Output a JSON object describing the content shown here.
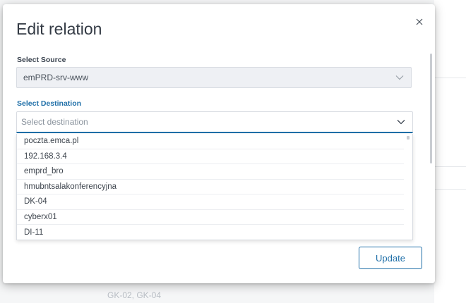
{
  "modal": {
    "title": "Edit relation",
    "close_icon": "close-icon"
  },
  "source": {
    "label": "Select Source",
    "value": "emPRD-srv-www"
  },
  "destination": {
    "label": "Select Destination",
    "placeholder": "Select destination",
    "options": [
      "poczta.emca.pl",
      "192.168.3.4",
      "emprd_bro",
      "hmubntsalakonferencyjna",
      "DK-04",
      "cyberx01",
      "DI-11"
    ]
  },
  "actions": {
    "update_label": "Update"
  },
  "background": {
    "partial_text": "GK-02, GK-04"
  },
  "colors": {
    "accent": "#1f6fa8",
    "source_bg": "#eef0f4"
  }
}
